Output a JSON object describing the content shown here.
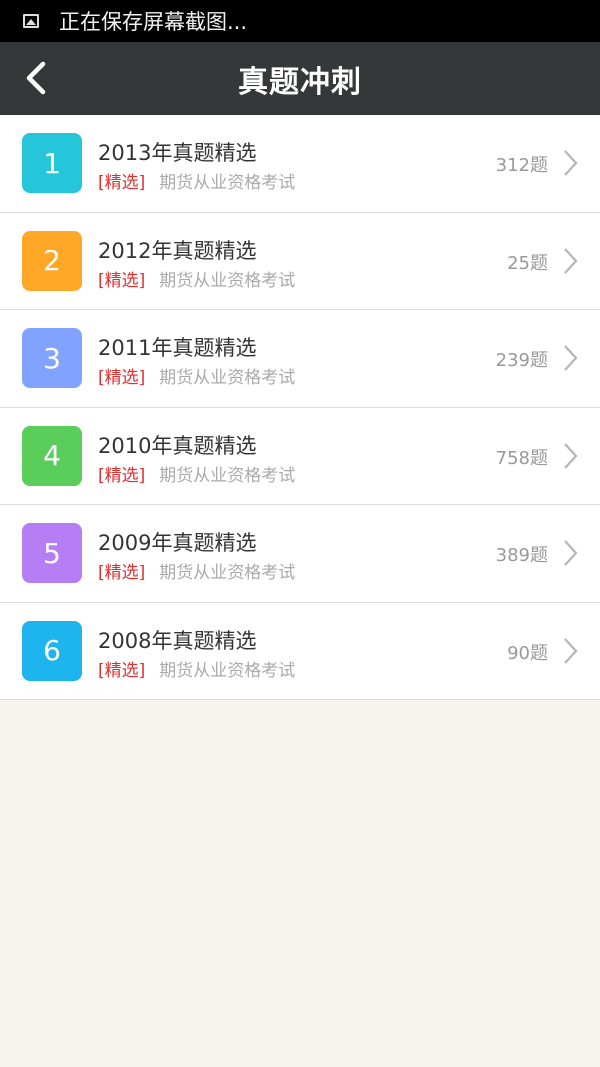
{
  "status_bar": {
    "text": "正在保存屏幕截图..."
  },
  "app_bar": {
    "title": "真题冲刺"
  },
  "items": [
    {
      "number": "1",
      "title": "2013年真题精选",
      "tag": "[精选]",
      "category": "期货从业资格考试",
      "count": "312题",
      "color": "#26c6da"
    },
    {
      "number": "2",
      "title": "2012年真题精选",
      "tag": "[精选]",
      "category": "期货从业资格考试",
      "count": "25题",
      "color": "#ffa726"
    },
    {
      "number": "3",
      "title": "2011年真题精选",
      "tag": "[精选]",
      "category": "期货从业资格考试",
      "count": "239题",
      "color": "#82a2ff"
    },
    {
      "number": "4",
      "title": "2010年真题精选",
      "tag": "[精选]",
      "category": "期货从业资格考试",
      "count": "758题",
      "color": "#5acd5a"
    },
    {
      "number": "5",
      "title": "2009年真题精选",
      "tag": "[精选]",
      "category": "期货从业资格考试",
      "count": "389题",
      "color": "#b57ef5"
    },
    {
      "number": "6",
      "title": "2008年真题精选",
      "tag": "[精选]",
      "category": "期货从业资格考试",
      "count": "90题",
      "color": "#1eb5ee"
    }
  ]
}
